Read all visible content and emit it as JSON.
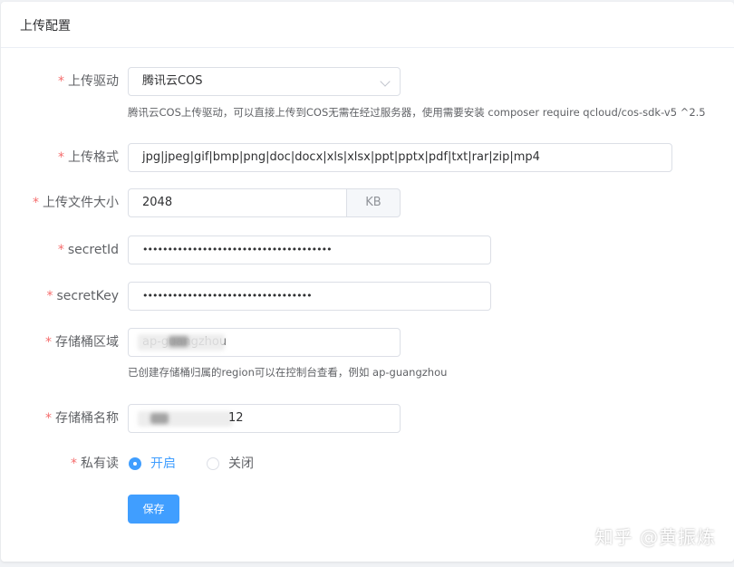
{
  "card": {
    "title": "上传配置"
  },
  "form": {
    "driver": {
      "label": "上传驱动",
      "required": "*",
      "value": "腾讯云COS",
      "hint": "腾讯云COS上传驱动，可以直接上传到COS无需在经过服务器，使用需要安装 composer require qcloud/cos-sdk-v5 ^2.5"
    },
    "format": {
      "label": "上传格式",
      "required": "*",
      "value": "jpg|jpeg|gif|bmp|png|doc|docx|xls|xlsx|ppt|pptx|pdf|txt|rar|zip|mp4"
    },
    "size": {
      "label": "上传文件大小",
      "required": "*",
      "value": "2048",
      "unit": "KB"
    },
    "secret_id": {
      "label": "secretId",
      "required": "*",
      "value": "••••••••••••••••••••••••••••••••••••••"
    },
    "secret_key": {
      "label": "secretKey",
      "required": "*",
      "value": "••••••••••••••••••••••••••••••••••"
    },
    "region": {
      "label": "存储桶区域",
      "required": "*",
      "value": "ap-guangzhou",
      "hint": "已创建存储桶归属的region可以在控制台查看，例如 ap-guangzhou"
    },
    "bucket": {
      "label": "存储桶名称",
      "required": "*",
      "value": "12"
    },
    "private_read": {
      "label": "私有读",
      "required": "*",
      "options": [
        "开启",
        "关闭"
      ],
      "selected": "开启"
    },
    "save_label": "保存"
  },
  "watermark": "知乎 @黄振炼",
  "colors": {
    "primary": "#409eff",
    "required": "#f56c6c",
    "border": "#dcdfe6"
  }
}
